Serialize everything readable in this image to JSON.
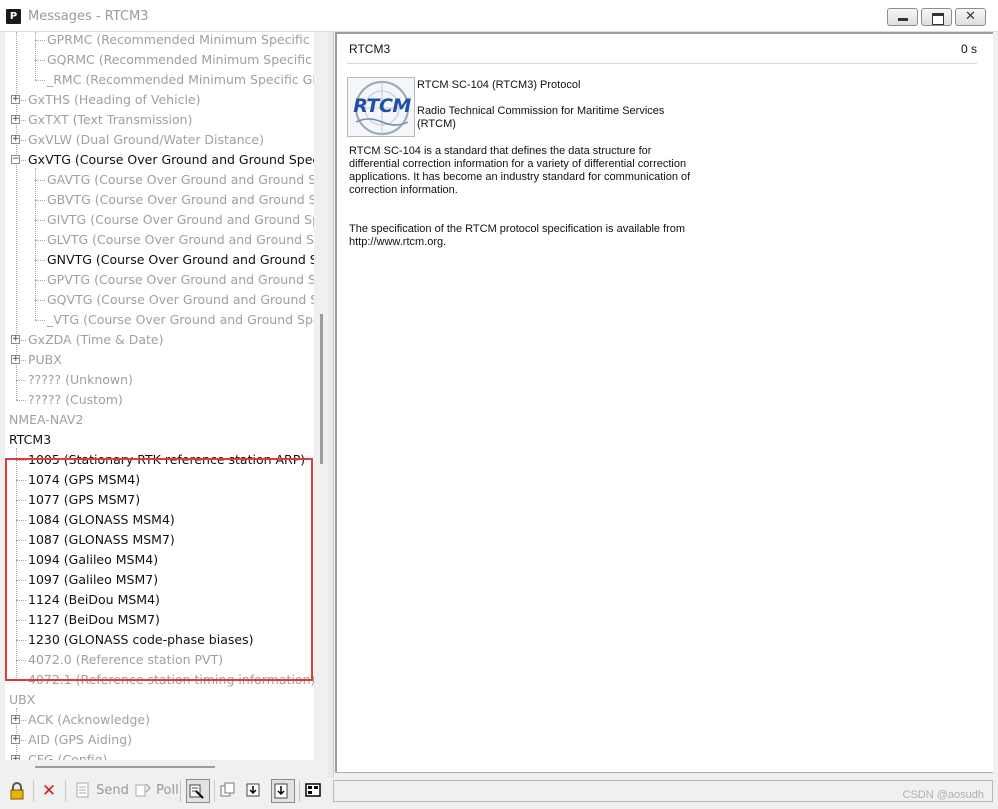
{
  "window": {
    "app_icon": "P",
    "title": "Messages - RTCM3",
    "min_icon": "minimize-icon",
    "max_icon": "maximize-icon",
    "close_glyph": "✕"
  },
  "tree": {
    "rows": [
      {
        "label": "GPRMC (Recommended Minimum Specific GN",
        "type": "leaf",
        "level": 2,
        "active": false
      },
      {
        "label": "GQRMC (Recommended Minimum Specific GN",
        "type": "leaf",
        "level": 2,
        "active": false
      },
      {
        "label": "_RMC (Recommended Minimum Specific GNS",
        "type": "leaf",
        "level": 2,
        "active": false
      },
      {
        "label": "GxTHS (Heading of Vehicle)",
        "type": "node",
        "level": 1,
        "expanded": false,
        "active": false
      },
      {
        "label": "GxTXT (Text Transmission)",
        "type": "node",
        "level": 1,
        "expanded": false,
        "active": false
      },
      {
        "label": "GxVLW (Dual Ground/Water Distance)",
        "type": "node",
        "level": 1,
        "expanded": false,
        "active": false
      },
      {
        "label": "GxVTG (Course Over Ground and Ground Speed)",
        "type": "node",
        "level": 1,
        "expanded": true,
        "active": true
      },
      {
        "label": "GAVTG (Course Over Ground and Ground Spe",
        "type": "leaf",
        "level": 2,
        "active": false
      },
      {
        "label": "GBVTG (Course Over Ground and Ground Spe",
        "type": "leaf",
        "level": 2,
        "active": false
      },
      {
        "label": "GIVTG (Course Over Ground and Ground Spe",
        "type": "leaf",
        "level": 2,
        "active": false
      },
      {
        "label": "GLVTG (Course Over Ground and Ground Spe",
        "type": "leaf",
        "level": 2,
        "active": false
      },
      {
        "label": "GNVTG (Course Over Ground and Ground Sp",
        "type": "leaf",
        "level": 2,
        "active": true
      },
      {
        "label": "GPVTG (Course Over Ground and Ground Spe",
        "type": "leaf",
        "level": 2,
        "active": false
      },
      {
        "label": "GQVTG (Course Over Ground and Ground Sp",
        "type": "leaf",
        "level": 2,
        "active": false
      },
      {
        "label": "_VTG (Course Over Ground and Ground Spee",
        "type": "leaf",
        "level": 2,
        "active": false
      },
      {
        "label": "GxZDA (Time & Date)",
        "type": "node",
        "level": 1,
        "expanded": false,
        "active": false
      },
      {
        "label": "PUBX",
        "type": "node",
        "level": 1,
        "expanded": false,
        "active": false
      },
      {
        "label": "????? (Unknown)",
        "type": "leaf",
        "level": 1,
        "active": false
      },
      {
        "label": "????? (Custom)",
        "type": "leaf",
        "level": 1,
        "active": false
      },
      {
        "label": "NMEA-NAV2",
        "type": "root",
        "level": 0,
        "active": false
      },
      {
        "label": "RTCM3",
        "type": "root",
        "level": 0,
        "active": true
      },
      {
        "label": "1005 (Stationary RTK reference station ARP)",
        "type": "leaf",
        "level": 1,
        "active": true
      },
      {
        "label": "1074 (GPS MSM4)",
        "type": "leaf",
        "level": 1,
        "active": true
      },
      {
        "label": "1077 (GPS MSM7)",
        "type": "leaf",
        "level": 1,
        "active": true
      },
      {
        "label": "1084 (GLONASS MSM4)",
        "type": "leaf",
        "level": 1,
        "active": true
      },
      {
        "label": "1087 (GLONASS MSM7)",
        "type": "leaf",
        "level": 1,
        "active": true
      },
      {
        "label": "1094 (Galileo MSM4)",
        "type": "leaf",
        "level": 1,
        "active": true
      },
      {
        "label": "1097 (Galileo MSM7)",
        "type": "leaf",
        "level": 1,
        "active": true
      },
      {
        "label": "1124 (BeiDou MSM4)",
        "type": "leaf",
        "level": 1,
        "active": true
      },
      {
        "label": "1127 (BeiDou MSM7)",
        "type": "leaf",
        "level": 1,
        "active": true
      },
      {
        "label": "1230 (GLONASS code-phase biases)",
        "type": "leaf",
        "level": 1,
        "active": true
      },
      {
        "label": "4072.0 (Reference station PVT)",
        "type": "leaf",
        "level": 1,
        "active": false
      },
      {
        "label": "4072.1 (Reference station timing information)",
        "type": "leaf",
        "level": 1,
        "active": false
      },
      {
        "label": "UBX",
        "type": "root",
        "level": 0,
        "active": false
      },
      {
        "label": "ACK (Acknowledge)",
        "type": "node",
        "level": 1,
        "expanded": false,
        "active": false
      },
      {
        "label": "AID (GPS Aiding)",
        "type": "node",
        "level": 1,
        "expanded": false,
        "active": false
      },
      {
        "label": "CFG (Config)",
        "type": "node",
        "level": 1,
        "expanded": false,
        "active": false
      }
    ]
  },
  "content": {
    "header": "RTCM3",
    "elapsed": "0 s",
    "logo_text": "RTCM",
    "protocol_title": "RTCM SC-104 (RTCM3) Protocol",
    "org_name": "Radio Technical Commission for Maritime Services (RTCM)",
    "description": "RTCM SC-104 is a standard that defines the data structure for differential correction information for a variety of differential correction applications. It has become an industry standard for communication of correction information.",
    "spec_note": "The specification of the RTCM protocol specification is available from http://www.rtcm.org."
  },
  "toolbar": {
    "lock_icon": "lock-icon",
    "delete_icon": "delete-icon",
    "send_label": "Send",
    "poll_label": "Poll",
    "watermark": "CSDN @aosudh"
  }
}
